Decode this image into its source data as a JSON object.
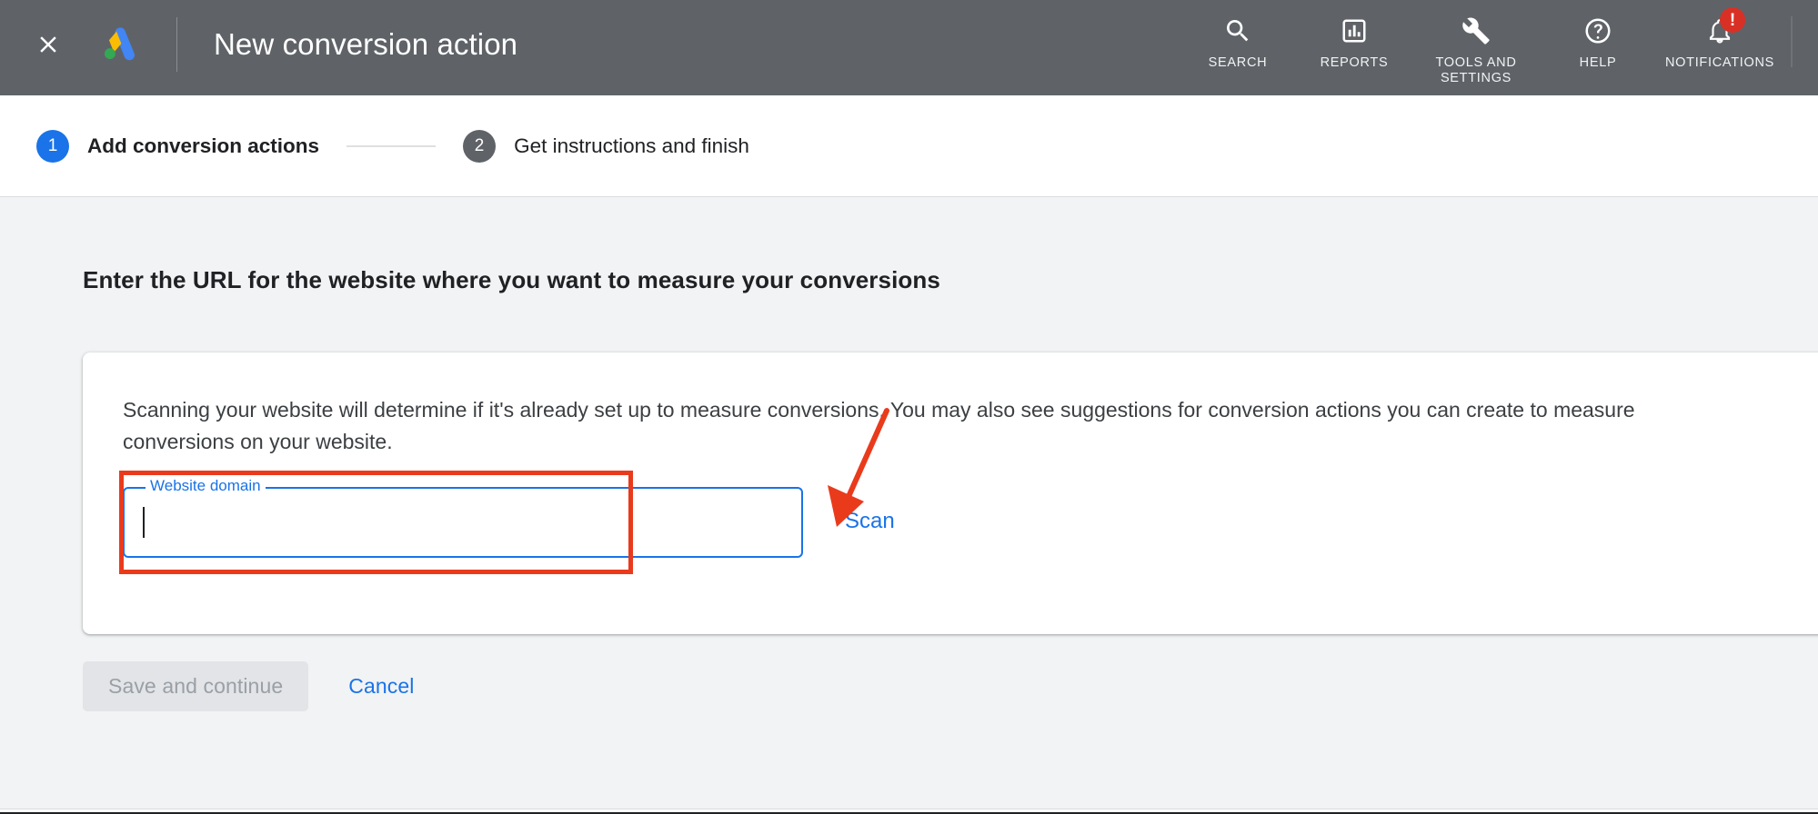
{
  "header": {
    "close_icon": "close-icon",
    "logo": "google-ads-logo",
    "title": "New conversion action",
    "items": [
      {
        "icon": "search-icon",
        "label": "SEARCH"
      },
      {
        "icon": "reports-icon",
        "label": "REPORTS"
      },
      {
        "icon": "wrench-icon",
        "label": "TOOLS AND\nSETTINGS"
      },
      {
        "icon": "help-icon",
        "label": "HELP"
      },
      {
        "icon": "bell-icon",
        "label": "NOTIFICATIONS",
        "badge": "!"
      }
    ]
  },
  "stepper": {
    "steps": [
      {
        "number": "1",
        "label": "Add conversion actions",
        "state": "active"
      },
      {
        "number": "2",
        "label": "Get instructions and finish",
        "state": "inactive"
      }
    ]
  },
  "main": {
    "heading": "Enter the URL for the website where you want to measure your conversions",
    "card": {
      "description": "Scanning your website will determine if it's already set up to measure conversions. You may also see suggestions for conversion actions you can create to measure conversions on your website.",
      "field": {
        "label": "Website domain",
        "value": "",
        "placeholder": ""
      },
      "scan_label": "Scan"
    }
  },
  "actions": {
    "save_label": "Save and continue",
    "cancel_label": "Cancel"
  },
  "colors": {
    "header_bg": "#5f6368",
    "accent_blue": "#1a73e8",
    "page_bg": "#f1f3f4",
    "annotation_red": "#ea3a1c",
    "badge_red": "#d93025",
    "disabled_btn": "#e2e4e7"
  }
}
